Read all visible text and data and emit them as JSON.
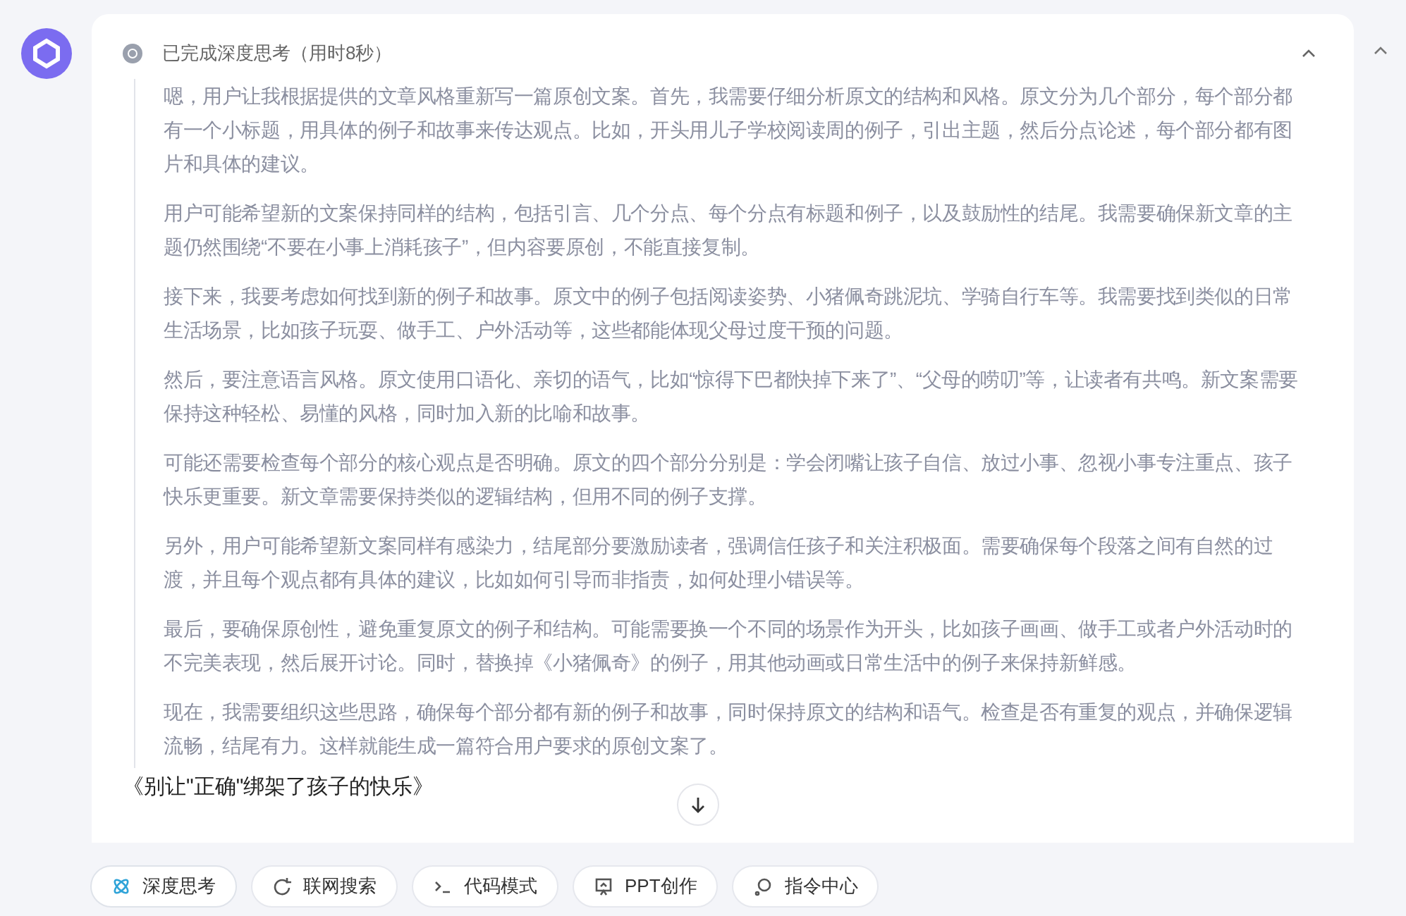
{
  "thinking": {
    "title": "已完成深度思考（用时8秒）",
    "expanded": true,
    "paragraphs": [
      "嗯，用户让我根据提供的文章风格重新写一篇原创文案。首先，我需要仔细分析原文的结构和风格。原文分为几个部分，每个部分都有一个小标题，用具体的例子和故事来传达观点。比如，开头用儿子学校阅读周的例子，引出主题，然后分点论述，每个部分都有图片和具体的建议。",
      "用户可能希望新的文案保持同样的结构，包括引言、几个分点、每个分点有标题和例子，以及鼓励性的结尾。我需要确保新文章的主题仍然围绕“不要在小事上消耗孩子”，但内容要原创，不能直接复制。",
      "接下来，我要考虑如何找到新的例子和故事。原文中的例子包括阅读姿势、小猪佩奇跳泥坑、学骑自行车等。我需要找到类似的日常生活场景，比如孩子玩耍、做手工、户外活动等，这些都能体现父母过度干预的问题。",
      "然后，要注意语言风格。原文使用口语化、亲切的语气，比如“惊得下巴都快掉下来了”、“父母的唠叨”等，让读者有共鸣。新文案需要保持这种轻松、易懂的风格，同时加入新的比喻和故事。",
      "可能还需要检查每个部分的核心观点是否明确。原文的四个部分分别是：学会闭嘴让孩子自信、放过小事、忽视小事专注重点、孩子快乐更重要。新文章需要保持类似的逻辑结构，但用不同的例子支撑。",
      "另外，用户可能希望新文案同样有感染力，结尾部分要激励读者，强调信任孩子和关注积极面。需要确保每个段落之间有自然的过渡，并且每个观点都有具体的建议，比如如何引导而非指责，如何处理小错误等。",
      "最后，要确保原创性，避免重复原文的例子和结构。可能需要换一个不同的场景作为开头，比如孩子画画、做手工或者户外活动时的不完美表现，然后展开讨论。同时，替换掉《小猪佩奇》的例子，用其他动画或日常生活中的例子来保持新鲜感。",
      "现在，我需要组织这些思路，确保每个部分都有新的例子和故事，同时保持原文的结构和语气。检查是否有重复的观点，并确保逻辑流畅，结尾有力。这样就能生成一篇符合用户要求的原创文案了。"
    ]
  },
  "answer_title": "《别让\"正确\"绑架了孩子的快乐》",
  "toolbar": [
    {
      "kind": "deep",
      "label": "深度思考",
      "selected": true
    },
    {
      "kind": "web",
      "label": "联网搜索",
      "selected": false
    },
    {
      "kind": "code",
      "label": "代码模式",
      "selected": false
    },
    {
      "kind": "ppt",
      "label": "PPT创作",
      "selected": false
    },
    {
      "kind": "cmd",
      "label": "指令中心",
      "selected": false
    }
  ]
}
